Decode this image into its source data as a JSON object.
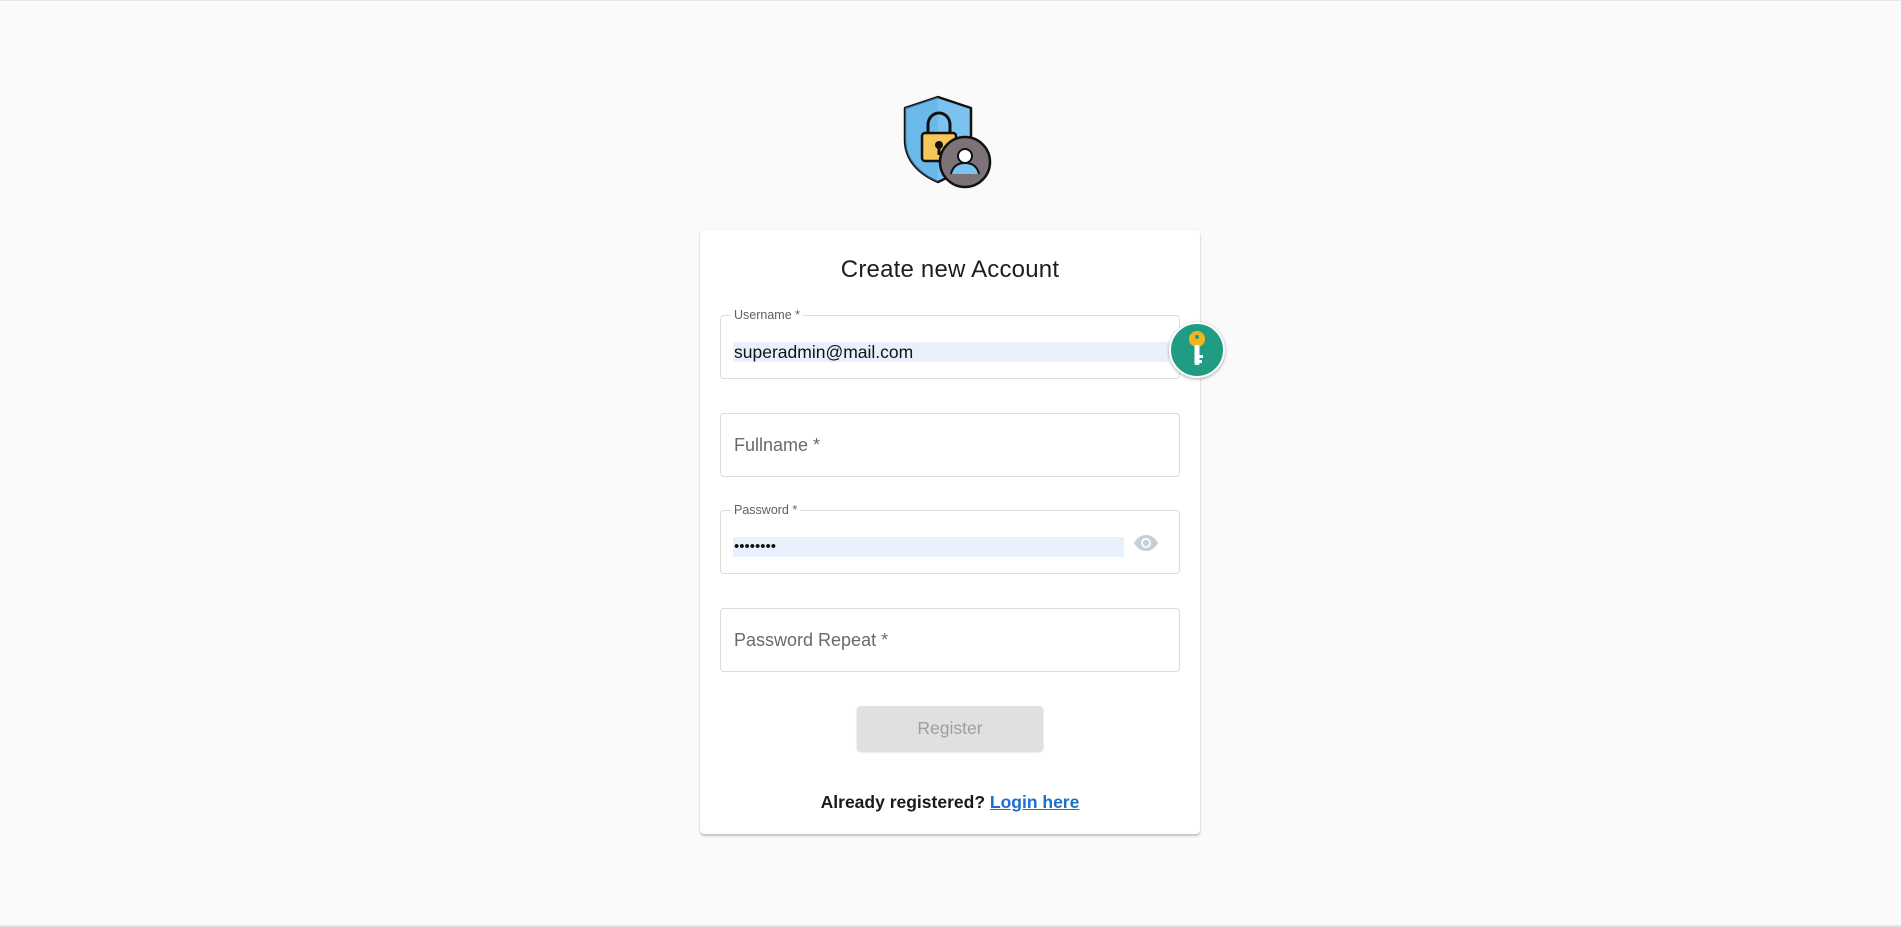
{
  "form": {
    "title": "Create new Account",
    "username": {
      "label": "Username *",
      "value": "superadmin@mail.com"
    },
    "fullname": {
      "placeholder": "Fullname *"
    },
    "password": {
      "label": "Password *",
      "value": "••••••••"
    },
    "password_repeat": {
      "placeholder": "Password Repeat *"
    },
    "register_label": "Register",
    "already_text": "Already registered?",
    "login_link": "Login here"
  },
  "icons": {
    "logo": "shield-lock-user-icon",
    "password_manager": "key-icon",
    "visibility": "eye-icon"
  },
  "colors": {
    "background": "#fafafa",
    "card": "#ffffff",
    "autofill": "#e8f0fe",
    "link": "#1a6fd1",
    "key_badge": "#1f9c82",
    "button_disabled": "#e0e0e0"
  }
}
